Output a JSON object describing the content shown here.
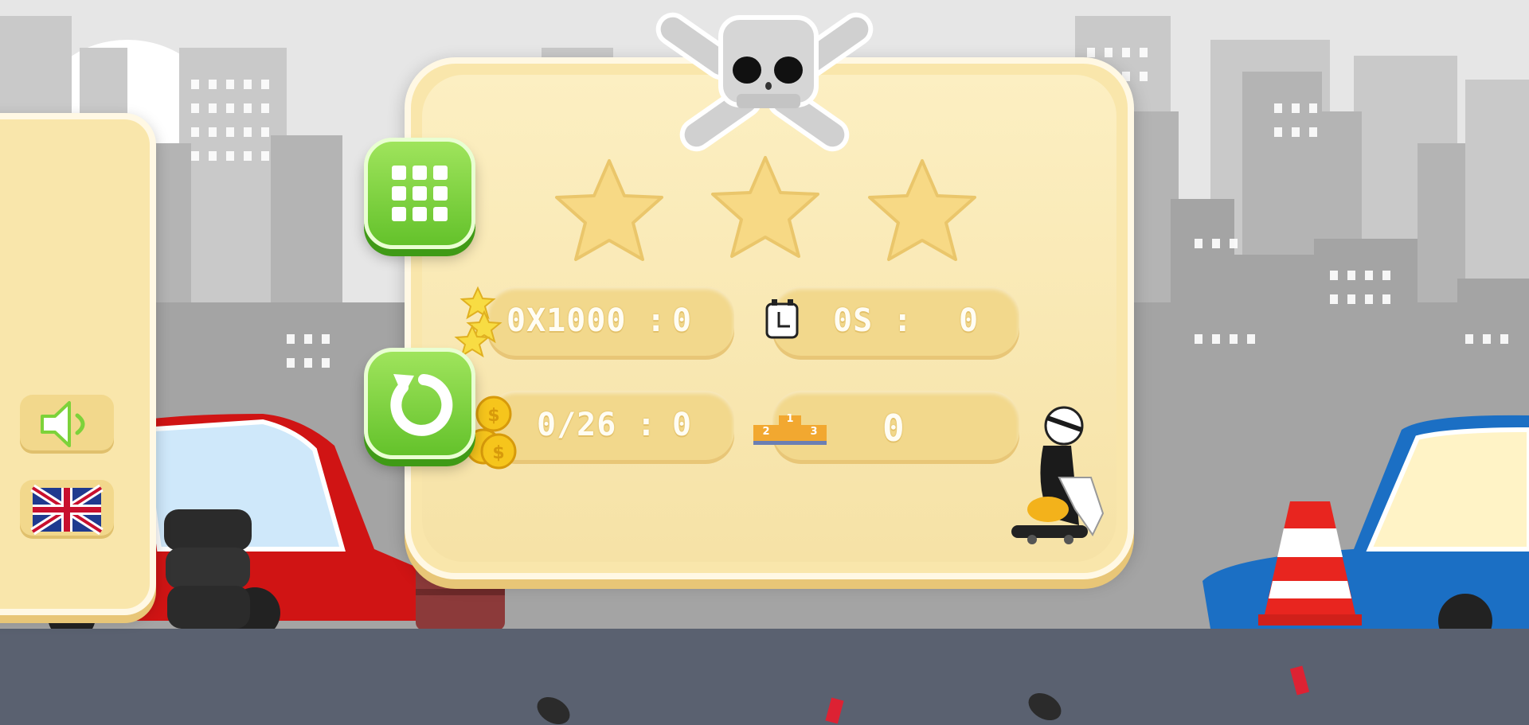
{
  "score": {
    "stars_multiplier_label": "0X1000 :",
    "stars_value": "0",
    "time_label": "0S :",
    "time_value": "0",
    "coins_label": "0/26 :",
    "coins_value": "0",
    "rank_value": "0"
  },
  "stars_earned": 0,
  "stars_total": 3,
  "podium": {
    "first": "1",
    "second": "2",
    "third": "3"
  },
  "icons": {
    "header": "skull-crossbones-icon",
    "menu_button": "level-grid-icon",
    "restart_button": "restart-icon",
    "sound_button": "speaker-icon",
    "language_button": "flag-icon"
  },
  "colors": {
    "panel": "#f9e6ab",
    "stat_box": "#f2d88c",
    "button_green": "#78d23b",
    "road": "#5a6170"
  }
}
